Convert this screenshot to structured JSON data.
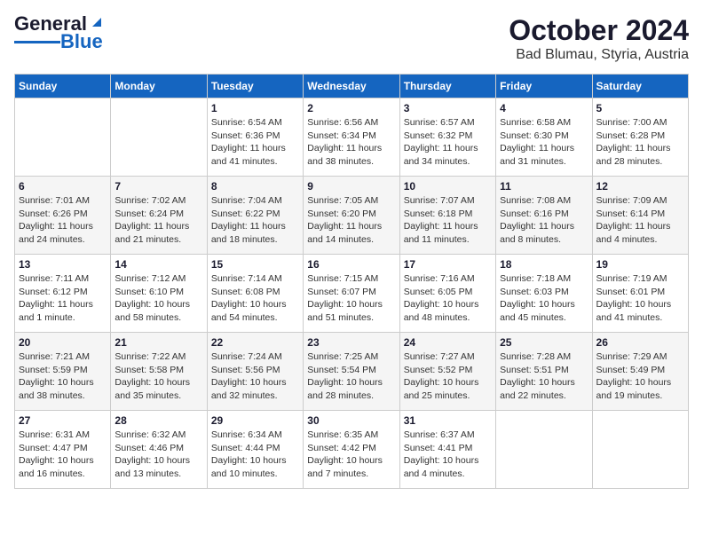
{
  "logo": {
    "line1": "General",
    "line2": "Blue"
  },
  "title": "October 2024",
  "subtitle": "Bad Blumau, Styria, Austria",
  "days_of_week": [
    "Sunday",
    "Monday",
    "Tuesday",
    "Wednesday",
    "Thursday",
    "Friday",
    "Saturday"
  ],
  "weeks": [
    [
      {
        "day": "",
        "info": ""
      },
      {
        "day": "",
        "info": ""
      },
      {
        "day": "1",
        "info": "Sunrise: 6:54 AM\nSunset: 6:36 PM\nDaylight: 11 hours and 41 minutes."
      },
      {
        "day": "2",
        "info": "Sunrise: 6:56 AM\nSunset: 6:34 PM\nDaylight: 11 hours and 38 minutes."
      },
      {
        "day": "3",
        "info": "Sunrise: 6:57 AM\nSunset: 6:32 PM\nDaylight: 11 hours and 34 minutes."
      },
      {
        "day": "4",
        "info": "Sunrise: 6:58 AM\nSunset: 6:30 PM\nDaylight: 11 hours and 31 minutes."
      },
      {
        "day": "5",
        "info": "Sunrise: 7:00 AM\nSunset: 6:28 PM\nDaylight: 11 hours and 28 minutes."
      }
    ],
    [
      {
        "day": "6",
        "info": "Sunrise: 7:01 AM\nSunset: 6:26 PM\nDaylight: 11 hours and 24 minutes."
      },
      {
        "day": "7",
        "info": "Sunrise: 7:02 AM\nSunset: 6:24 PM\nDaylight: 11 hours and 21 minutes."
      },
      {
        "day": "8",
        "info": "Sunrise: 7:04 AM\nSunset: 6:22 PM\nDaylight: 11 hours and 18 minutes."
      },
      {
        "day": "9",
        "info": "Sunrise: 7:05 AM\nSunset: 6:20 PM\nDaylight: 11 hours and 14 minutes."
      },
      {
        "day": "10",
        "info": "Sunrise: 7:07 AM\nSunset: 6:18 PM\nDaylight: 11 hours and 11 minutes."
      },
      {
        "day": "11",
        "info": "Sunrise: 7:08 AM\nSunset: 6:16 PM\nDaylight: 11 hours and 8 minutes."
      },
      {
        "day": "12",
        "info": "Sunrise: 7:09 AM\nSunset: 6:14 PM\nDaylight: 11 hours and 4 minutes."
      }
    ],
    [
      {
        "day": "13",
        "info": "Sunrise: 7:11 AM\nSunset: 6:12 PM\nDaylight: 11 hours and 1 minute."
      },
      {
        "day": "14",
        "info": "Sunrise: 7:12 AM\nSunset: 6:10 PM\nDaylight: 10 hours and 58 minutes."
      },
      {
        "day": "15",
        "info": "Sunrise: 7:14 AM\nSunset: 6:08 PM\nDaylight: 10 hours and 54 minutes."
      },
      {
        "day": "16",
        "info": "Sunrise: 7:15 AM\nSunset: 6:07 PM\nDaylight: 10 hours and 51 minutes."
      },
      {
        "day": "17",
        "info": "Sunrise: 7:16 AM\nSunset: 6:05 PM\nDaylight: 10 hours and 48 minutes."
      },
      {
        "day": "18",
        "info": "Sunrise: 7:18 AM\nSunset: 6:03 PM\nDaylight: 10 hours and 45 minutes."
      },
      {
        "day": "19",
        "info": "Sunrise: 7:19 AM\nSunset: 6:01 PM\nDaylight: 10 hours and 41 minutes."
      }
    ],
    [
      {
        "day": "20",
        "info": "Sunrise: 7:21 AM\nSunset: 5:59 PM\nDaylight: 10 hours and 38 minutes."
      },
      {
        "day": "21",
        "info": "Sunrise: 7:22 AM\nSunset: 5:58 PM\nDaylight: 10 hours and 35 minutes."
      },
      {
        "day": "22",
        "info": "Sunrise: 7:24 AM\nSunset: 5:56 PM\nDaylight: 10 hours and 32 minutes."
      },
      {
        "day": "23",
        "info": "Sunrise: 7:25 AM\nSunset: 5:54 PM\nDaylight: 10 hours and 28 minutes."
      },
      {
        "day": "24",
        "info": "Sunrise: 7:27 AM\nSunset: 5:52 PM\nDaylight: 10 hours and 25 minutes."
      },
      {
        "day": "25",
        "info": "Sunrise: 7:28 AM\nSunset: 5:51 PM\nDaylight: 10 hours and 22 minutes."
      },
      {
        "day": "26",
        "info": "Sunrise: 7:29 AM\nSunset: 5:49 PM\nDaylight: 10 hours and 19 minutes."
      }
    ],
    [
      {
        "day": "27",
        "info": "Sunrise: 6:31 AM\nSunset: 4:47 PM\nDaylight: 10 hours and 16 minutes."
      },
      {
        "day": "28",
        "info": "Sunrise: 6:32 AM\nSunset: 4:46 PM\nDaylight: 10 hours and 13 minutes."
      },
      {
        "day": "29",
        "info": "Sunrise: 6:34 AM\nSunset: 4:44 PM\nDaylight: 10 hours and 10 minutes."
      },
      {
        "day": "30",
        "info": "Sunrise: 6:35 AM\nSunset: 4:42 PM\nDaylight: 10 hours and 7 minutes."
      },
      {
        "day": "31",
        "info": "Sunrise: 6:37 AM\nSunset: 4:41 PM\nDaylight: 10 hours and 4 minutes."
      },
      {
        "day": "",
        "info": ""
      },
      {
        "day": "",
        "info": ""
      }
    ]
  ]
}
